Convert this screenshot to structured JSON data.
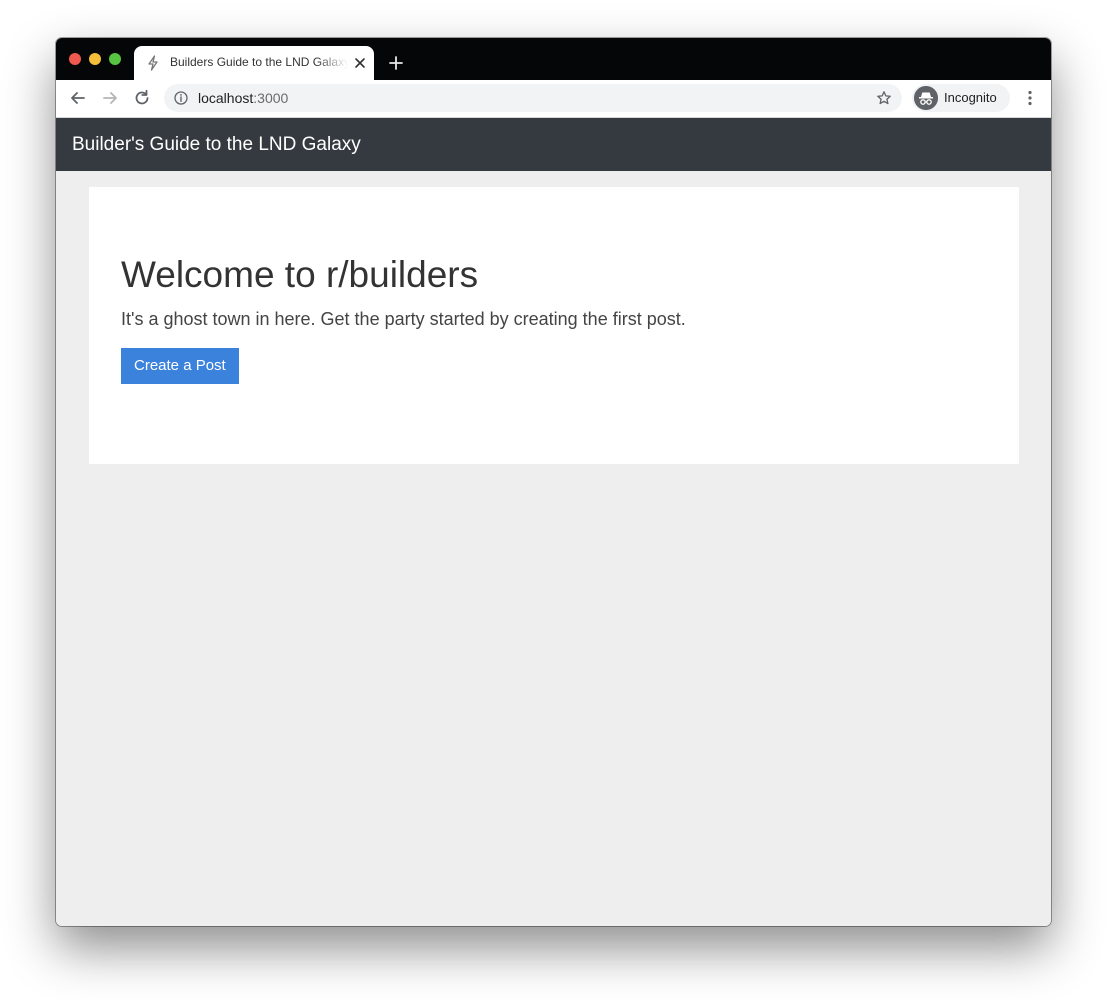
{
  "browser": {
    "tab": {
      "title": "Builders Guide to the LND Galaxy"
    },
    "address_bar": {
      "host": "localhost",
      "port": ":3000"
    },
    "profile": {
      "label": "Incognito"
    }
  },
  "navbar": {
    "brand": "Builder's Guide to the LND Galaxy"
  },
  "jumbotron": {
    "heading": "Welcome to r/builders",
    "lead": "It's a ghost town in here. Get the party started by creating the first post.",
    "cta_label": "Create a Post"
  },
  "colors": {
    "navbar_bg": "#343a40",
    "button_primary": "#3b82dc",
    "page_bg": "#eeeeee"
  }
}
